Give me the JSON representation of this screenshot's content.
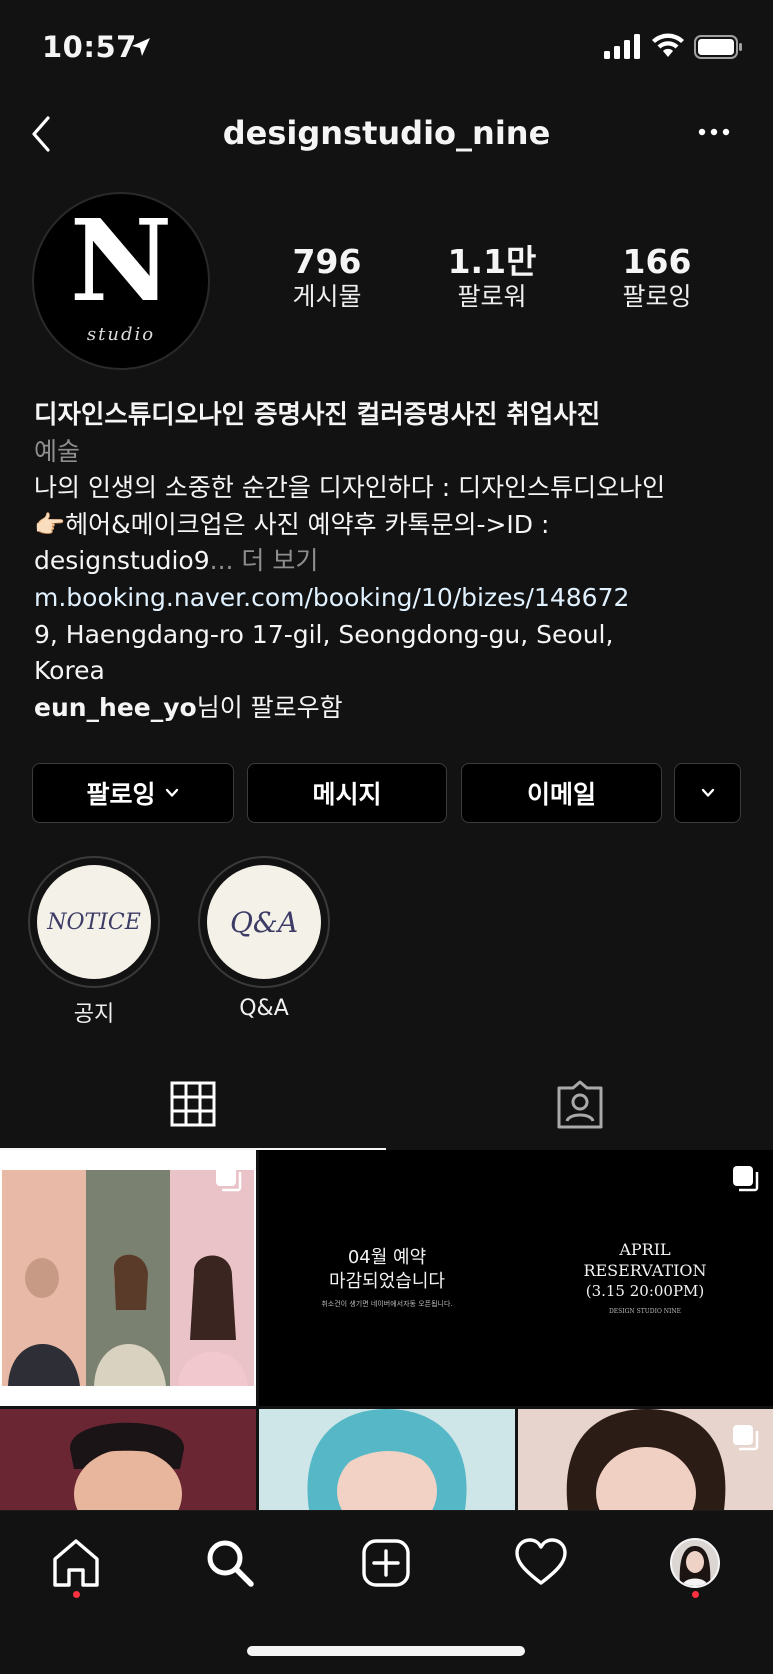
{
  "status_bar": {
    "time": "10:57"
  },
  "header": {
    "username": "designstudio_nine"
  },
  "avatar": {
    "logo_letter": "N",
    "logo_sub": "studio"
  },
  "stats": [
    {
      "value": "796",
      "label": "게시물"
    },
    {
      "value": "1.1만",
      "label": "팔로워"
    },
    {
      "value": "166",
      "label": "팔로잉"
    }
  ],
  "bio": {
    "name": "디자인스튜디오나인 증명사진 컬러증명사진 취업사진",
    "category": "예술",
    "line1": "나의 인생의 소중한 순간을 디자인하다 : 디자인스튜디오나인",
    "line2": "👉🏻헤어&메이크업은 사진 예약후 카톡문의->ID :",
    "line3": "designstudio9",
    "more": "... 더 보기",
    "link": "m.booking.naver.com/booking/10/bizes/148672",
    "address1": "9, Haengdang-ro 17-gil, Seongdong-gu, Seoul,",
    "address2": "Korea",
    "followed_by_user": "eun_hee_yo",
    "followed_by_suffix": "님이 팔로우함"
  },
  "actions": {
    "follow": "팔로잉",
    "message": "메시지",
    "email": "이메일"
  },
  "highlights": [
    {
      "cover_text": "NOTICE",
      "label": "공지"
    },
    {
      "cover_text": "Q&A",
      "label": "Q&A"
    }
  ],
  "posts": {
    "p2_ko_line1": "04월 예약",
    "p2_ko_line2": "마감되었습니다",
    "p2_ko_small": "취소건이 생기면 네이버에서자동 오픈됩니다.",
    "p2_en_line1": "APRIL",
    "p2_en_line2": "RESERVATION",
    "p2_en_line3": "(3.15 20:00PM)",
    "p2_en_small": "DESIGN STUDIO NINE"
  },
  "colors": {
    "background": "#121212",
    "text": "#f5f5f5",
    "muted": "#8e8e8e",
    "notification": "#ff3040"
  }
}
